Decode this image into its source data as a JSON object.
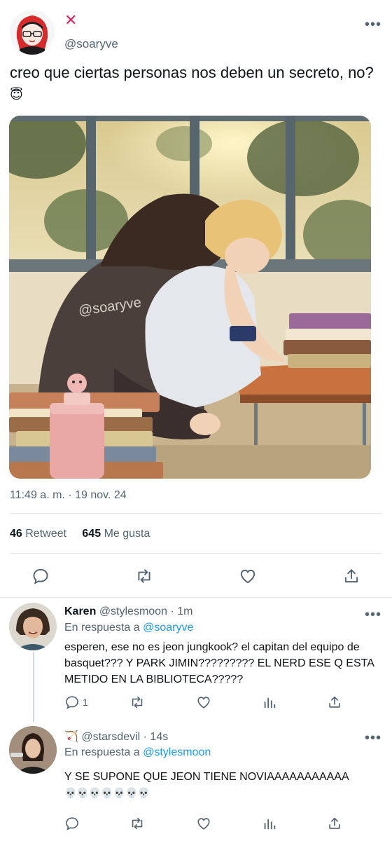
{
  "tweet": {
    "badge_glyph": "✕",
    "handle": "@soaryve",
    "text": "creo que ciertas personas nos deben un secreto, no?",
    "emoji": "😇",
    "media_watermark": "@soaryve",
    "timestamp": "11:49 a. m. · 19 nov. 24",
    "retweets_count": "46",
    "retweets_label": "Retweet",
    "likes_count": "645",
    "likes_label": "Me gusta",
    "more_glyph": "•••"
  },
  "actions": {
    "reply_icon": "reply-icon",
    "retweet_icon": "retweet-icon",
    "like_icon": "heart-icon",
    "share_icon": "share-icon"
  },
  "replies": [
    {
      "name": "Karen",
      "handle": "@stylesmoon",
      "time": "· 1m",
      "reply_prefix": "En respuesta a",
      "reply_to": "@soaryve",
      "text": "esperen, ese no es jeon jungkook? el capitan del equipo de basquet??? Y PARK JIMIN????????? EL NERD ESE Q ESTA METIDO EN LA BIBLIOTECA?????",
      "reply_count": "1"
    },
    {
      "name_emoji": "🏹",
      "handle": "@starsdevil",
      "time": "· 14s",
      "reply_prefix": "En respuesta a",
      "reply_to": "@stylesmoon",
      "text": "Y SE SUPONE QUE JEON TIENE NOVIAAAAAAAAAAA",
      "skulls": "💀💀💀💀💀💀💀"
    }
  ],
  "colors": {
    "accent": "#1d9bf0",
    "text": "#0f1419",
    "muted": "#536471",
    "divider": "#e3e7ea",
    "badge": "#e0245e"
  }
}
